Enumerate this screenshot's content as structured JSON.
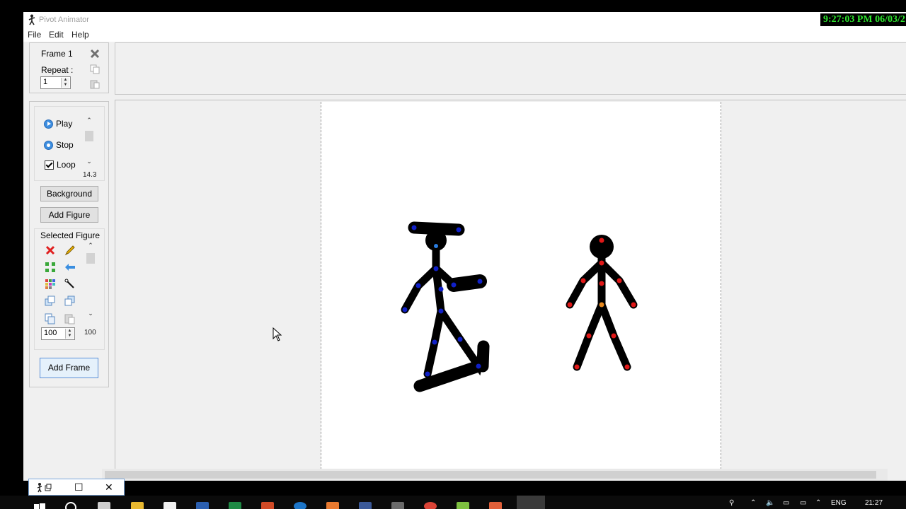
{
  "window": {
    "title": "Pivot Animator",
    "clock": "9:27:03 PM 06/03/2"
  },
  "menu": [
    "File",
    "Edit",
    "Help"
  ],
  "frame_panel": {
    "title": "Frame 1",
    "repeat_label": "Repeat :",
    "repeat_value": "1"
  },
  "playback": {
    "play_label": "Play",
    "stop_label": "Stop",
    "loop_label": "Loop",
    "loop_checked": true,
    "speed": "14.3"
  },
  "buttons": {
    "background": "Background",
    "add_figure": "Add Figure",
    "add_frame": "Add Frame"
  },
  "selected_figure": {
    "title": "Selected Figure",
    "size_value": "100",
    "scale_readout": "100"
  },
  "taskbar": {
    "language": "ENG",
    "time": "21:27"
  },
  "colors": {
    "clock_text": "#2ee82e",
    "joint_blue": "#1020c8",
    "joint_red": "#e01818",
    "joint_orange": "#e88a20",
    "figure_body": "#000000"
  }
}
